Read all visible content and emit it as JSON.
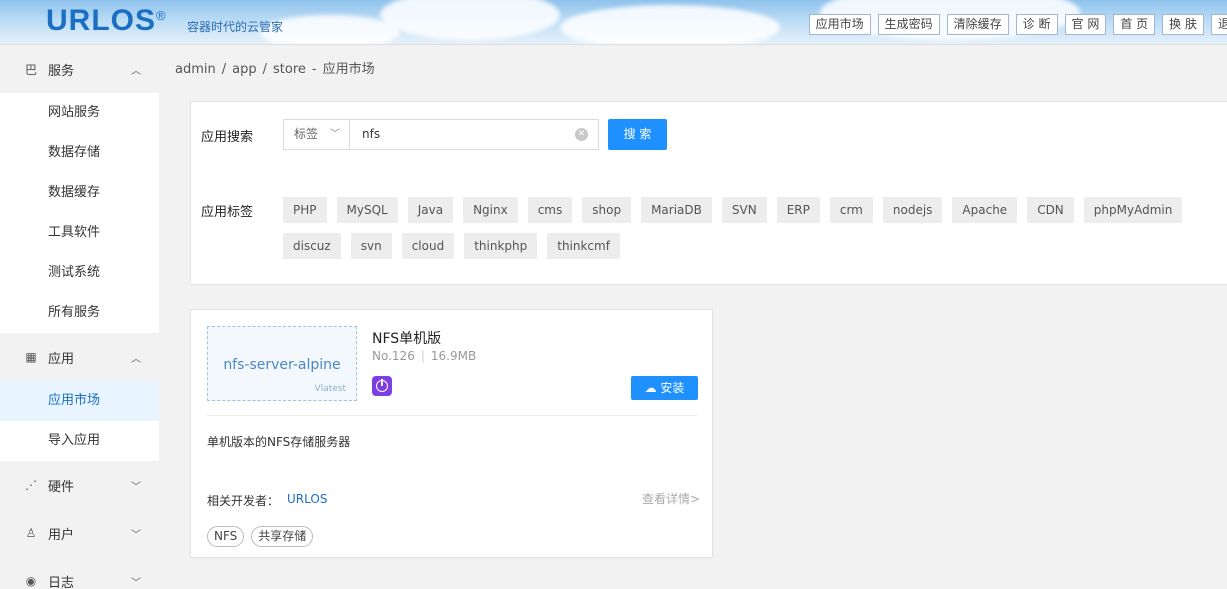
{
  "header": {
    "logo": "URLOS",
    "logo_mark": "®",
    "slogan": "容器时代的云管家",
    "nav": [
      "应用市场",
      "生成密码",
      "清除缓存",
      "诊 断",
      "官 网",
      "首 页",
      "换 肤",
      "退"
    ]
  },
  "sidebar": {
    "groups": [
      {
        "icon": "grid-icon",
        "label": "服务",
        "expanded": true,
        "items": [
          "网站服务",
          "数据存储",
          "数据缓存",
          "工具软件",
          "测试系统",
          "所有服务"
        ]
      },
      {
        "icon": "apps-icon",
        "label": "应用",
        "expanded": true,
        "items": [
          "应用市场",
          "导入应用"
        ]
      },
      {
        "icon": "share-icon",
        "label": "硬件",
        "expanded": false,
        "items": []
      },
      {
        "icon": "user-icon",
        "label": "用户",
        "expanded": false,
        "items": []
      },
      {
        "icon": "eye-icon",
        "label": "日志",
        "expanded": false,
        "items": []
      }
    ],
    "active_item": "应用市场"
  },
  "breadcrumb": {
    "parts": [
      "admin",
      "/",
      "app",
      "/",
      "store",
      "-",
      "应用市场"
    ]
  },
  "search": {
    "label": "应用搜索",
    "select_value": "标签",
    "input_value": "nfs",
    "button": "搜 索"
  },
  "tags": {
    "label": "应用标签",
    "items": [
      "PHP",
      "MySQL",
      "Java",
      "Nginx",
      "cms",
      "shop",
      "MariaDB",
      "SVN",
      "ERP",
      "crm",
      "nodejs",
      "Apache",
      "CDN",
      "phpMyAdmin",
      "discuz",
      "svn",
      "cloud",
      "thinkphp",
      "thinkcmf"
    ]
  },
  "app": {
    "thumb_name": "nfs-server-alpine",
    "thumb_version": "Vlatest",
    "title": "NFS单机版",
    "number": "No.126",
    "size": "16.9MB",
    "install": "安装",
    "description": "单机版本的NFS存储服务器",
    "developer_label": "相关开发者：",
    "developer": "URLOS",
    "detail": "查看详情>",
    "tags": [
      "NFS",
      "共享存储"
    ]
  },
  "colors": {
    "accent": "#1e90ff",
    "active_bg": "#e8f4ff",
    "logo": "#1a6fc2"
  }
}
